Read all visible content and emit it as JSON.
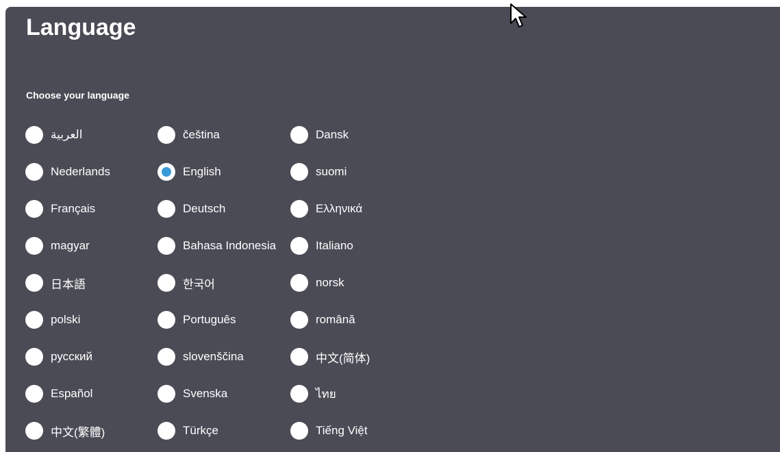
{
  "page": {
    "title": "Language",
    "section_label": "Choose your language"
  },
  "languages": [
    {
      "label": "العربية",
      "selected": false
    },
    {
      "label": "čeština",
      "selected": false
    },
    {
      "label": "Dansk",
      "selected": false
    },
    {
      "label": "Nederlands",
      "selected": false
    },
    {
      "label": "English",
      "selected": true
    },
    {
      "label": "suomi",
      "selected": false
    },
    {
      "label": "Français",
      "selected": false
    },
    {
      "label": "Deutsch",
      "selected": false
    },
    {
      "label": "Ελληνικά",
      "selected": false
    },
    {
      "label": "magyar",
      "selected": false
    },
    {
      "label": "Bahasa Indonesia",
      "selected": false
    },
    {
      "label": "Italiano",
      "selected": false
    },
    {
      "label": "日本語",
      "selected": false
    },
    {
      "label": "한국어",
      "selected": false
    },
    {
      "label": "norsk",
      "selected": false
    },
    {
      "label": "polski",
      "selected": false
    },
    {
      "label": "Português",
      "selected": false
    },
    {
      "label": "română",
      "selected": false
    },
    {
      "label": "русский",
      "selected": false
    },
    {
      "label": "slovenščina",
      "selected": false
    },
    {
      "label": "中文(简体)",
      "selected": false
    },
    {
      "label": "Español",
      "selected": false
    },
    {
      "label": "Svenska",
      "selected": false
    },
    {
      "label": "ไทย",
      "selected": false
    },
    {
      "label": "中文(繁體)",
      "selected": false
    },
    {
      "label": "Türkçe",
      "selected": false
    },
    {
      "label": "Tiếng Việt",
      "selected": false
    }
  ],
  "colors": {
    "panel_background": "#4a4b55",
    "text": "#ffffff",
    "radio_fill": "#ffffff",
    "radio_selected_dot": "#3a9ad9"
  },
  "icons": {
    "cursor": "mouse-pointer-icon"
  }
}
